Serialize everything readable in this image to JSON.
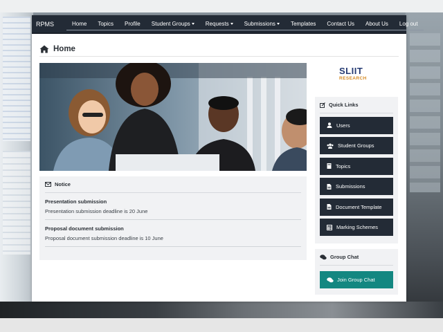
{
  "navbar": {
    "brand": "RPMS",
    "items": [
      {
        "label": "Home",
        "dropdown": false
      },
      {
        "label": "Topics",
        "dropdown": false
      },
      {
        "label": "Profile",
        "dropdown": false
      },
      {
        "label": "Student Groups",
        "dropdown": true
      },
      {
        "label": "Requests",
        "dropdown": true
      },
      {
        "label": "Submissions",
        "dropdown": true
      },
      {
        "label": "Templates",
        "dropdown": false
      },
      {
        "label": "Contact Us",
        "dropdown": false
      },
      {
        "label": "About Us",
        "dropdown": false
      },
      {
        "label": "Log out",
        "dropdown": false
      }
    ]
  },
  "page": {
    "title": "Home",
    "icon": "home-icon"
  },
  "notice": {
    "heading": "Notice",
    "items": [
      {
        "title": "Presentation submission",
        "body": "Presentation submission deadline is 20 June"
      },
      {
        "title": "Proposal document submission",
        "body": "Proposal document submission deadline is 10 June"
      }
    ]
  },
  "logo": {
    "text": "SLIIT",
    "sub": "RESEARCH"
  },
  "quick_links": {
    "heading": "Quick Links",
    "items": [
      {
        "label": "Users",
        "icon": "user-icon"
      },
      {
        "label": "Student Groups",
        "icon": "users-icon"
      },
      {
        "label": "Topics",
        "icon": "book-icon"
      },
      {
        "label": "Submissions",
        "icon": "file-icon"
      },
      {
        "label": "Document Template",
        "icon": "file-icon"
      },
      {
        "label": "Marking Schemes",
        "icon": "table-icon"
      }
    ]
  },
  "group_chat": {
    "heading": "Group Chat",
    "button_label": "Join Group Chat"
  },
  "colors": {
    "navbar": "#232b36",
    "chat_button": "#138781",
    "logo_blue": "#263b73",
    "logo_orange": "#d68a22"
  }
}
